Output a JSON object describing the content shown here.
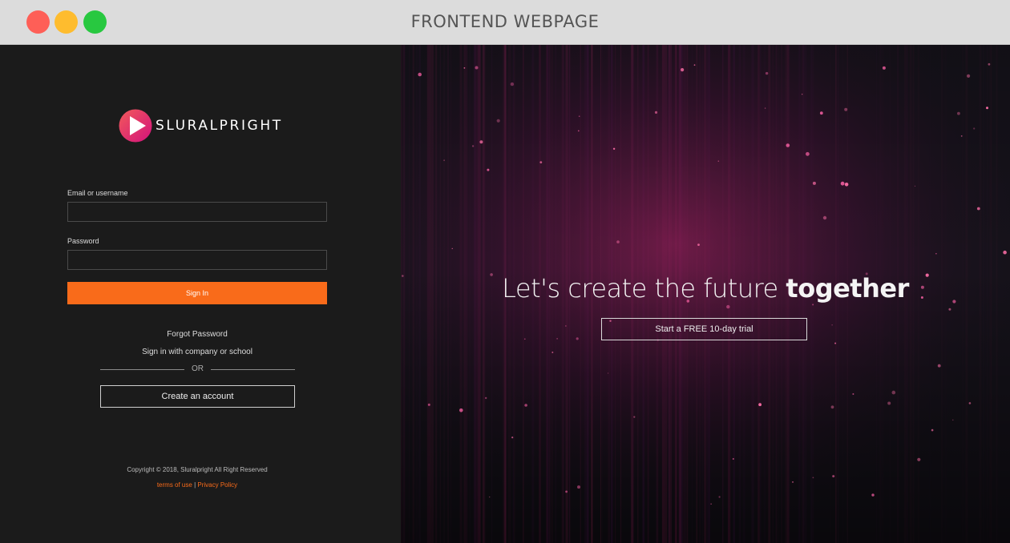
{
  "window": {
    "title": "FRONTEND WEBPAGE",
    "controls": [
      "close",
      "minimize",
      "maximize"
    ]
  },
  "brand": {
    "name": "SLURALPRIGHT",
    "icon": "play-icon",
    "colors": {
      "gradient_start": "#f14a6b",
      "gradient_end": "#d3127c"
    }
  },
  "login": {
    "email_label": "Email or username",
    "email_value": "",
    "password_label": "Password",
    "password_value": "",
    "signin_label": "Sign In",
    "forgot_label": "Forgot Password",
    "company_label": "Sign in with company or school",
    "or_label": "OR",
    "create_label": "Create an account"
  },
  "footer": {
    "copyright": "Copyright © 2018, Sluralpright All Right Reserved",
    "terms_label": "terms of use",
    "separator": "|",
    "privacy_label": "Privacy Policy"
  },
  "hero": {
    "title_light": "Let's create the future",
    "title_bold": "together",
    "cta_label": "Start a FREE 10-day trial"
  },
  "colors": {
    "accent": "#f96b1a",
    "background": "#1b1b1b",
    "titlebar": "#dcdcdc"
  }
}
